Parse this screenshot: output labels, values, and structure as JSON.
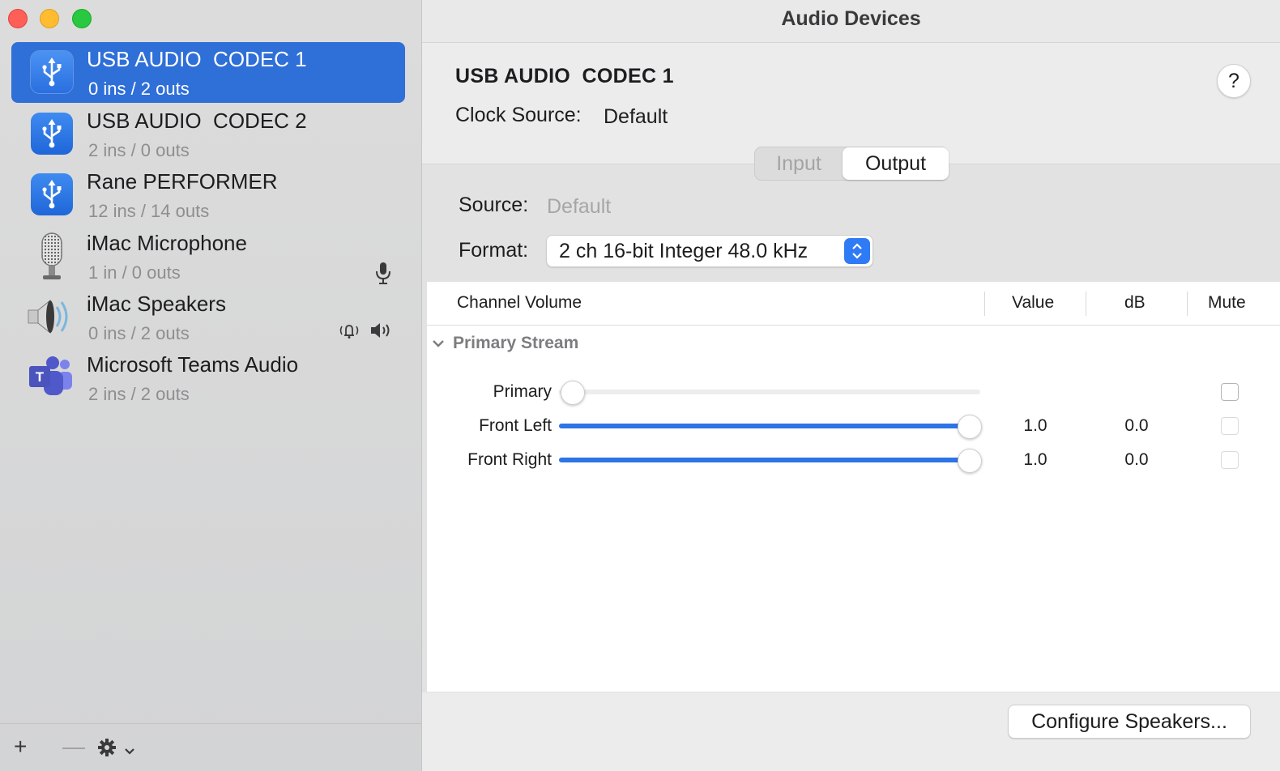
{
  "window": {
    "title": "Audio Devices"
  },
  "devices": [
    {
      "name": "USB AUDIO  CODEC 1",
      "io": "0 ins / 2 outs",
      "icon": "usb-icon",
      "selected": true
    },
    {
      "name": "USB AUDIO  CODEC 2",
      "io": "2 ins / 0 outs",
      "icon": "usb-icon",
      "selected": false
    },
    {
      "name": "Rane PERFORMER",
      "io": "12 ins / 14 outs",
      "icon": "usb-icon",
      "selected": false
    },
    {
      "name": "iMac Microphone",
      "io": "1 in / 0 outs",
      "icon": "microphone-icon",
      "selected": false,
      "trailing_icons": [
        "microphone-indicator-icon"
      ]
    },
    {
      "name": "iMac Speakers",
      "io": "0 ins / 2 outs",
      "icon": "speaker-icon",
      "selected": false,
      "trailing_icons": [
        "alert-sound-icon",
        "speaker-output-icon"
      ]
    },
    {
      "name": "Microsoft Teams Audio",
      "io": "2 ins / 2 outs",
      "icon": "teams-icon",
      "selected": false
    }
  ],
  "footer": {
    "add": "+",
    "remove": "—",
    "icons": [
      "gear-icon",
      "chevron-down-icon"
    ]
  },
  "detail": {
    "device_name": "USB AUDIO  CODEC 1",
    "help": "?",
    "clock_source_label": "Clock Source:",
    "clock_source_value": "Default",
    "tabs": {
      "input": "Input",
      "output": "Output",
      "active": "Output"
    },
    "source_label": "Source:",
    "source_value": "Default",
    "format_label": "Format:",
    "format_value": "2 ch 16-bit Integer 48.0 kHz"
  },
  "table": {
    "headers": {
      "channel": "Channel Volume",
      "value": "Value",
      "db": "dB",
      "mute": "Mute"
    },
    "stream": "Primary Stream",
    "rows": [
      {
        "label": "Primary",
        "value": "",
        "db": "",
        "level": 0.0,
        "enabled": false,
        "muted": false
      },
      {
        "label": "Front Left",
        "value": "1.0",
        "db": "0.0",
        "level": 1.0,
        "enabled": true,
        "muted": false
      },
      {
        "label": "Front Right",
        "value": "1.0",
        "db": "0.0",
        "level": 1.0,
        "enabled": true,
        "muted": false
      }
    ]
  },
  "configure_button": "Configure Speakers...",
  "colors": {
    "accent": "#2f6fd8",
    "slider_fill": "#2d74e6",
    "close": "#fe5f57",
    "minimize": "#febc2e",
    "maximize": "#28c840"
  }
}
